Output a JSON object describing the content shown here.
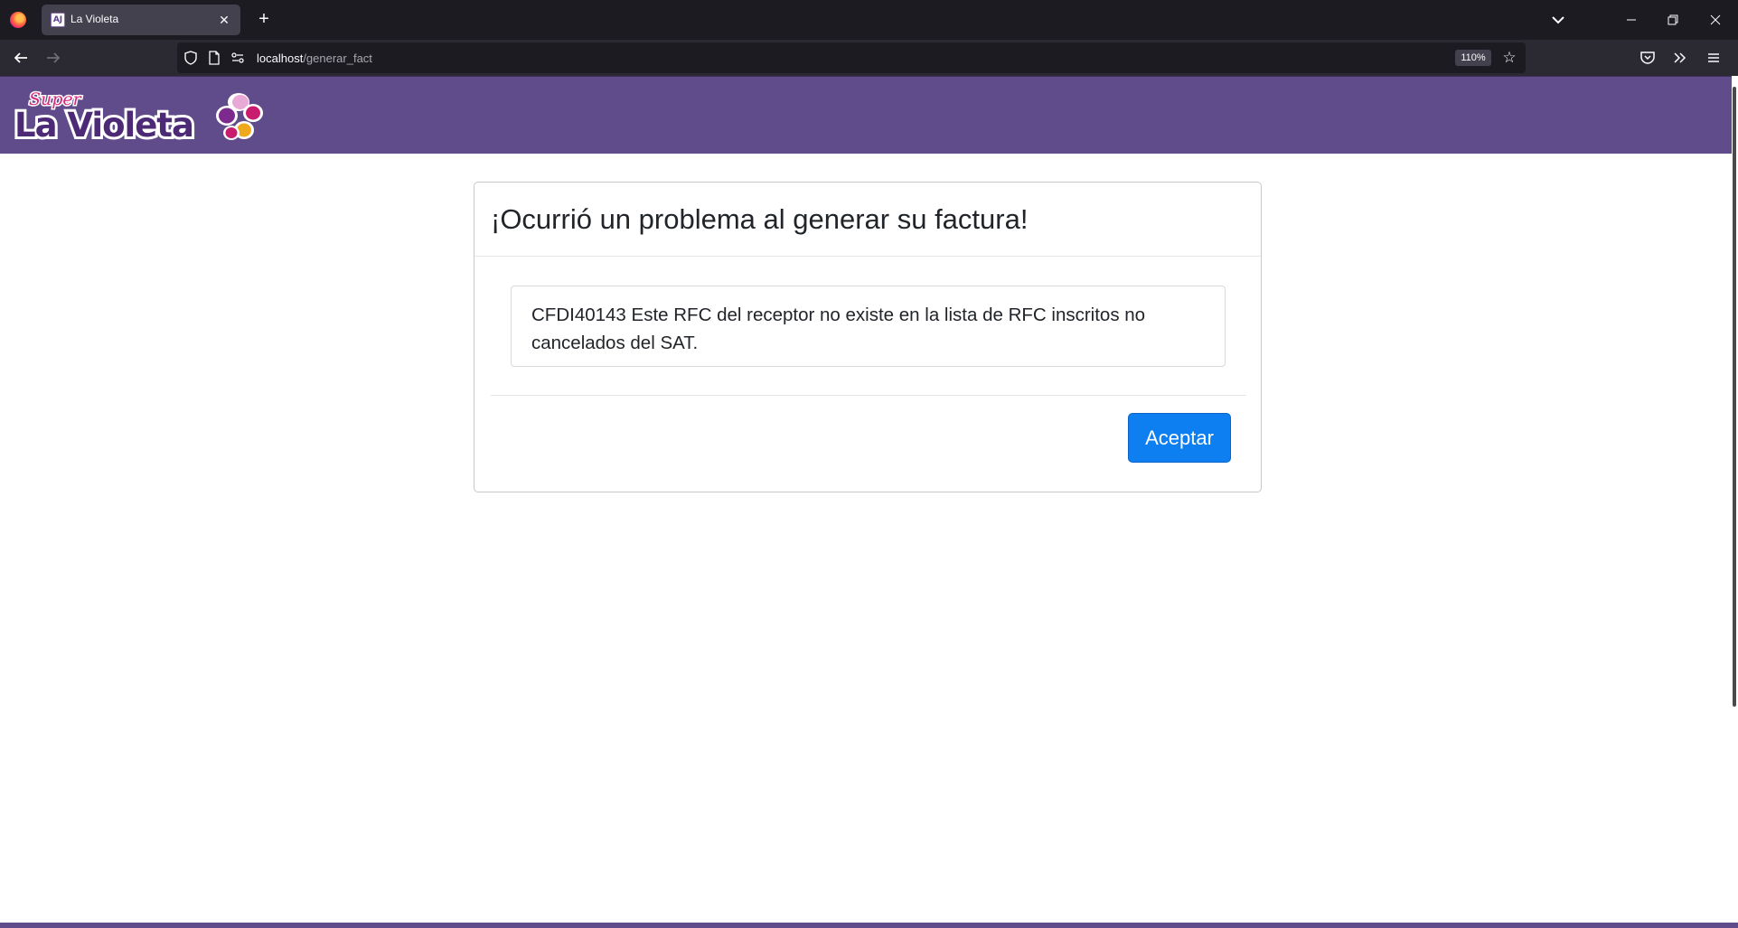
{
  "browser": {
    "tab_title": "La Violeta",
    "tab_favicon_text": "AJ",
    "url_host": "localhost",
    "url_path": "/generar_fact",
    "zoom_level": "110%"
  },
  "site": {
    "logo_script_text": "Super",
    "logo_main_text": "La Violeta",
    "header_color": "#604c8a"
  },
  "dialog": {
    "title": "¡Ocurrió un problema al generar su factura!",
    "message": "CFDI40143 Este RFC del receptor no existe en la lista de RFC inscritos no cancelados del SAT.",
    "accept_label": "Aceptar",
    "accent_color": "#0d7ff0"
  }
}
